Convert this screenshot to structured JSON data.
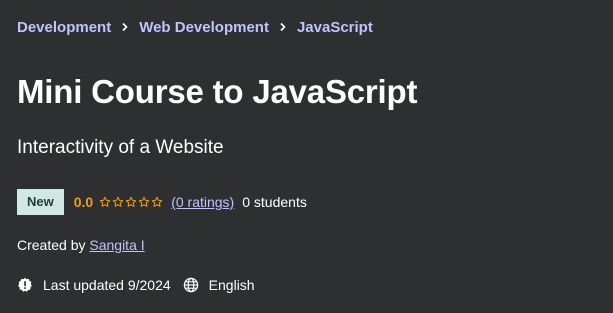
{
  "breadcrumb": {
    "items": [
      {
        "label": "Development"
      },
      {
        "label": "Web Development"
      },
      {
        "label": "JavaScript"
      }
    ]
  },
  "course": {
    "title": "Mini Course to JavaScript",
    "subtitle": "Interactivity of a Website",
    "badge": "New",
    "rating_value": "0.0",
    "ratings_count_label": "(0 ratings)",
    "students_label": "0 students",
    "created_by_prefix": "Created by",
    "author": "Sangita I",
    "last_updated": "Last updated 9/2024",
    "language": "English"
  },
  "icons": {
    "separator": "chevron-right-icon",
    "star": "star-outline-icon",
    "updated": "alert-badge-icon",
    "language": "globe-icon"
  },
  "colors": {
    "background": "#2d2f31",
    "link": "#c0c4fc",
    "rating": "#f69c08",
    "badge_bg": "#d1e8e2",
    "badge_text": "#1f3d37"
  }
}
